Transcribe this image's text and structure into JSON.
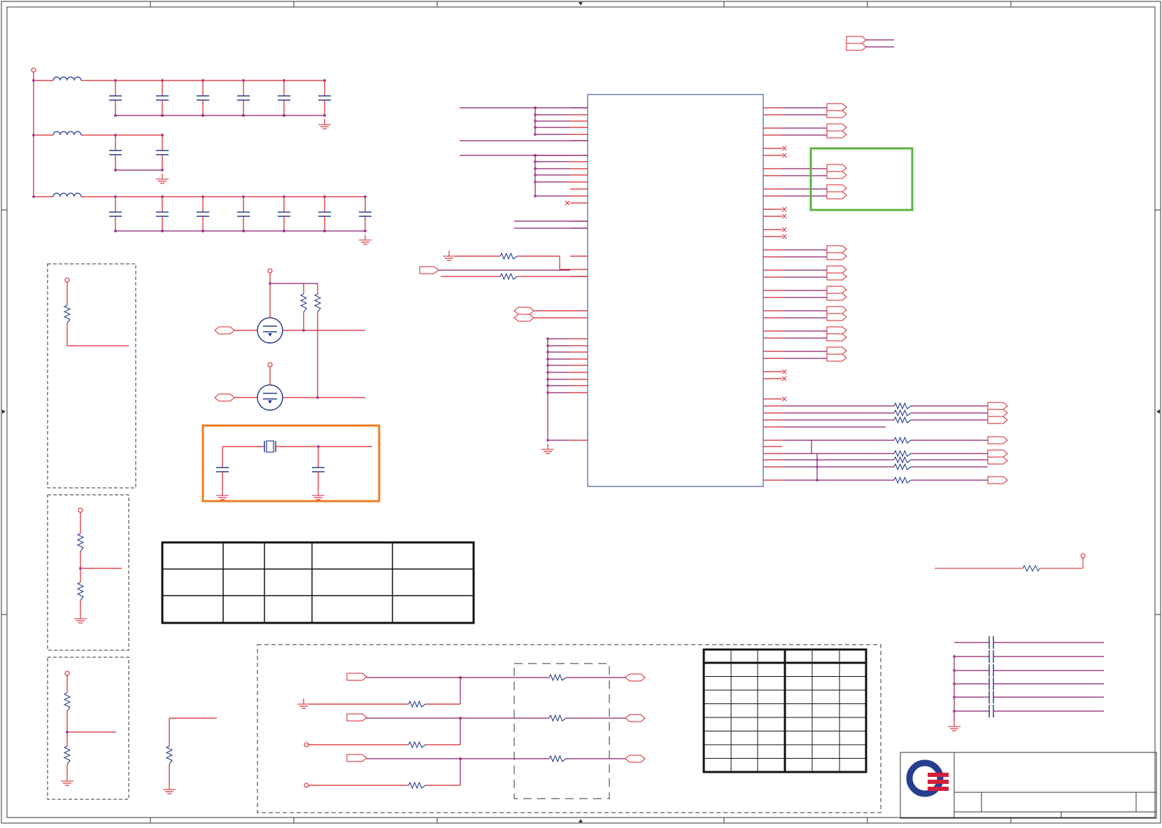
{
  "title_block": {
    "logo_icon": "company-logo-icon"
  },
  "colors": {
    "wire": "#d62027",
    "part": "#243d8f",
    "net": "#8a1f6a",
    "border": "#333333",
    "highlight_green": "#5bb33e",
    "highlight_orange": "#ed7d22",
    "table_line": "#111111"
  }
}
